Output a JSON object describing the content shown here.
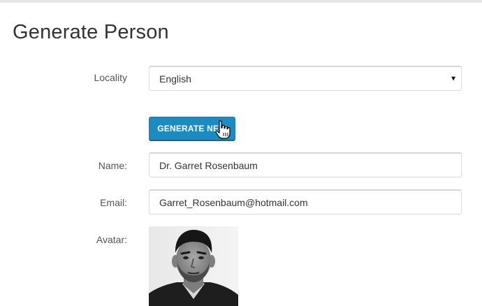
{
  "page": {
    "title": "Generate Person"
  },
  "form": {
    "locality": {
      "label": "Locality",
      "selected": "English"
    },
    "generate_button": "GENERATE NEW",
    "name": {
      "label": "Name:",
      "value": "Dr. Garret Rosenbaum"
    },
    "email": {
      "label": "Email:",
      "value": "Garret_Rosenbaum@hotmail.com"
    },
    "avatar": {
      "label": "Avatar:",
      "description": "portrait photo"
    }
  },
  "colors": {
    "button_bg": "#1c8bc1",
    "button_text": "#ffffff"
  },
  "icons": {
    "cursor": "hand-pointer-icon",
    "dropdown": "caret-down-icon"
  }
}
